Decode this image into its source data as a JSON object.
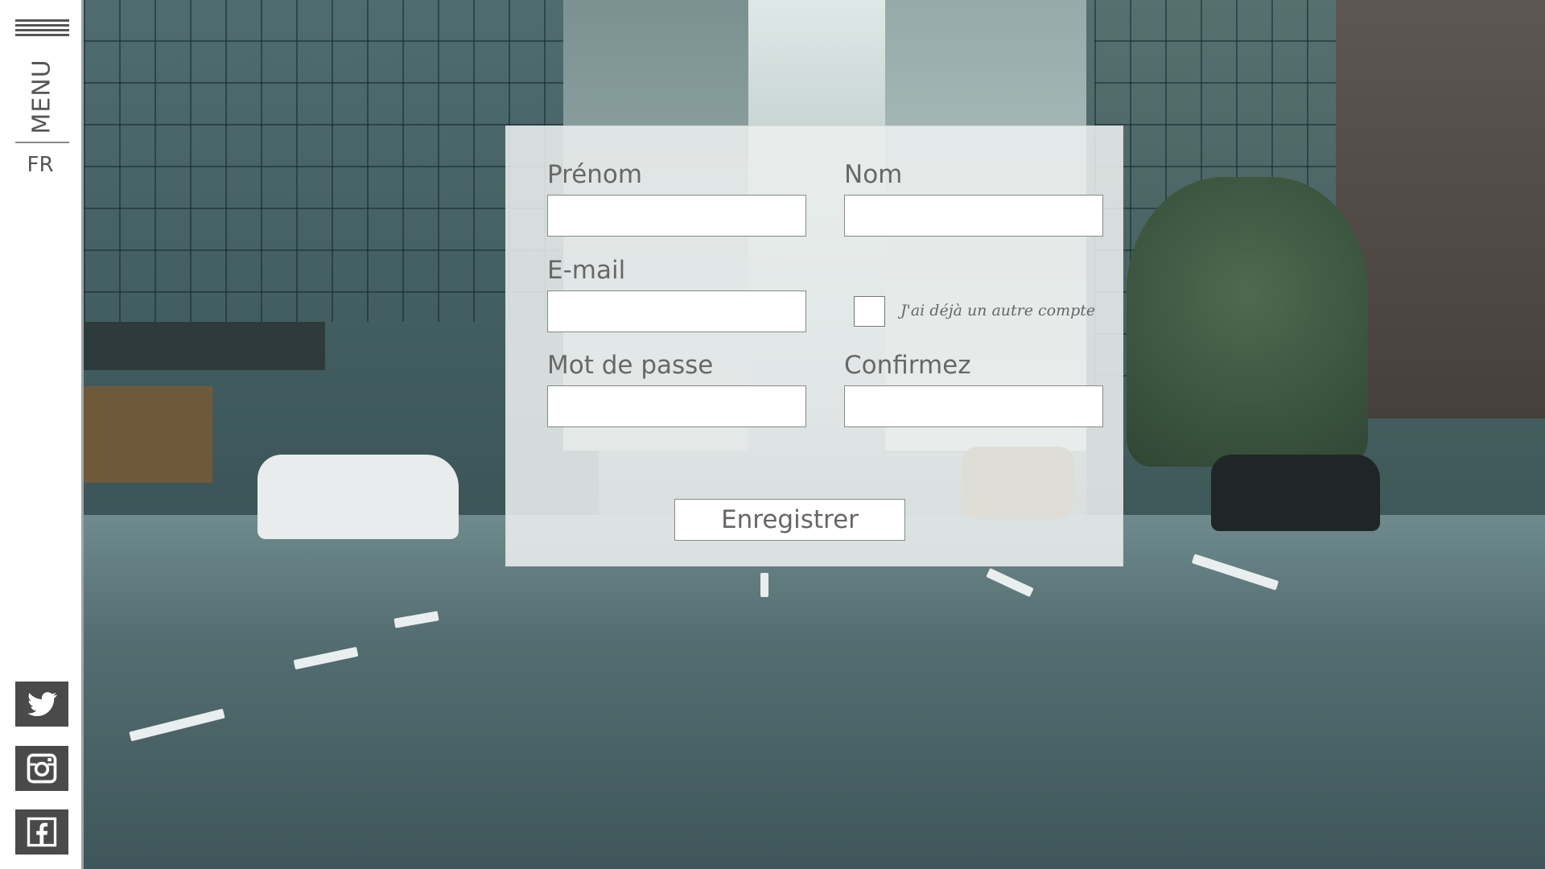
{
  "sidebar": {
    "menu_label": "MENU",
    "language": "FR",
    "social": [
      {
        "name": "twitter-icon"
      },
      {
        "name": "instagram-icon"
      },
      {
        "name": "facebook-icon"
      }
    ]
  },
  "form": {
    "first_name_label": "Prénom",
    "last_name_label": "Nom",
    "email_label": "E-mail",
    "password_label": "Mot de passe",
    "confirm_label": "Confirmez",
    "existing_account_label": "J'ai déjà un autre compte",
    "submit_label": "Enregistrer",
    "first_name_value": "",
    "last_name_value": "",
    "email_value": "",
    "password_value": "",
    "confirm_value": "",
    "existing_account_checked": false
  },
  "colors": {
    "sidebar_bg": "#ffffff",
    "icon_bg": "#4a4a4a",
    "label_text": "#686868",
    "panel_bg": "#eef1f0"
  }
}
